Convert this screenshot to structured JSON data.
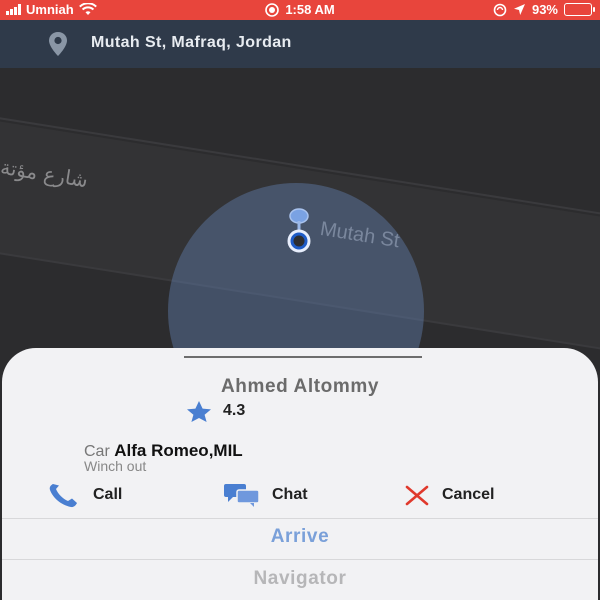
{
  "status_bar": {
    "carrier": "Umniah",
    "time": "1:58 AM",
    "battery": "93%",
    "background_color": "#e8453c"
  },
  "header": {
    "address": "Mutah St, Mafraq, Jordan",
    "icon": "location-pin-icon"
  },
  "map": {
    "street_label_en": "Mutah St",
    "street_label_ar": "شارع مؤتة"
  },
  "driver": {
    "name": "Ahmed Altommy",
    "rating": "4.3",
    "car_label": "Car",
    "car_model": "Alfa Romeo,MIL",
    "service_type": "Winch out"
  },
  "actions": {
    "call": "Call",
    "chat": "Chat",
    "cancel": "Cancel"
  },
  "buttons": {
    "arrive": "Arrive",
    "navigator": "Navigator"
  },
  "colors": {
    "accent_blue": "#4a7fd1",
    "cancel_red": "#e0392c",
    "arrive_text": "#7aa0d9"
  }
}
